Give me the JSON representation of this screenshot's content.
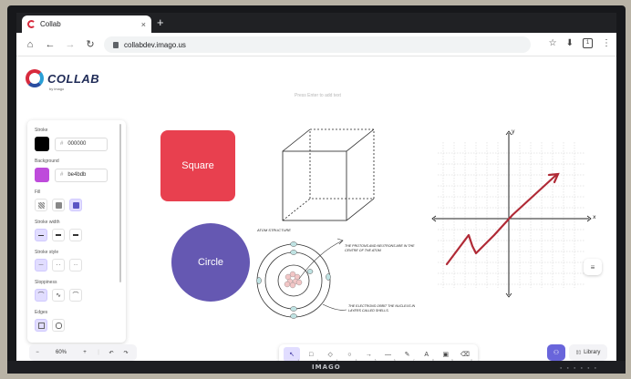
{
  "browser": {
    "tab_title": "Collab",
    "tab_close": "×",
    "new_tab": "+",
    "url": "collabdev.imago.us",
    "tab_count": "1",
    "nav": {
      "home": "⌂",
      "back": "←",
      "forward": "→",
      "reload": "↻",
      "star": "☆",
      "download": "⬇",
      "menu": "⋮"
    }
  },
  "app": {
    "logo_text": "COLLAB",
    "logo_by": "by imago",
    "canvas_hint": "Press Enter to add text"
  },
  "props": {
    "stroke_label": "Stroke",
    "stroke_hash": "#",
    "stroke_hex": "000000",
    "stroke_color": "#000000",
    "background_label": "Background",
    "background_hash": "#",
    "background_hex": "be4bdb",
    "background_color": "#be4bdb",
    "fill_label": "Fill",
    "stroke_width_label": "Stroke width",
    "stroke_style_label": "Stroke style",
    "stroke_style_glyphs": [
      "—",
      "- -",
      "···"
    ],
    "sloppiness_label": "Sloppiness",
    "sloppiness_glyphs": [
      "⌒",
      "∿",
      "⌒"
    ],
    "edges_label": "Edges"
  },
  "zoom": {
    "minus": "−",
    "value": "60%",
    "plus": "+",
    "undo": "↶",
    "redo": "↷"
  },
  "toolbar": {
    "tools": [
      {
        "icon": "cursor-icon",
        "glyph": "↖",
        "key": "1"
      },
      {
        "icon": "rectangle-icon",
        "glyph": "□",
        "key": "2"
      },
      {
        "icon": "diamond-icon",
        "glyph": "◇",
        "key": "3"
      },
      {
        "icon": "ellipse-icon",
        "glyph": "○",
        "key": "4"
      },
      {
        "icon": "arrow-icon",
        "glyph": "→",
        "key": "5"
      },
      {
        "icon": "line-icon",
        "glyph": "—",
        "key": "6"
      },
      {
        "icon": "pencil-icon",
        "glyph": "✎",
        "key": "7"
      },
      {
        "icon": "text-icon",
        "glyph": "A",
        "key": "8"
      },
      {
        "icon": "image-icon",
        "glyph": "▣",
        "key": "9"
      },
      {
        "icon": "eraser-icon",
        "glyph": "⌫",
        "key": "0"
      }
    ]
  },
  "library_label": "Library",
  "library_glyph": "▯▯",
  "user_glyph": "⚇",
  "menu_glyph": "≡",
  "canvas": {
    "square_label": "Square",
    "square_color": "#e8404f",
    "circle_label": "Circle",
    "circle_color": "#6558b2",
    "atom_title": "ATOM STRUCTURE",
    "atom_note_1": "THE PROTONS AND NEUTRONS ARE IN THE CENTRE OF THE ATOM",
    "atom_note_2": "THE ELECTRONS ORBIT THE NUCLEUS IN LAYERS CALLED SHELLS.",
    "graph_x_label": "x",
    "graph_y_label": "y"
  },
  "bezel": {
    "brand": "IMAGO"
  }
}
